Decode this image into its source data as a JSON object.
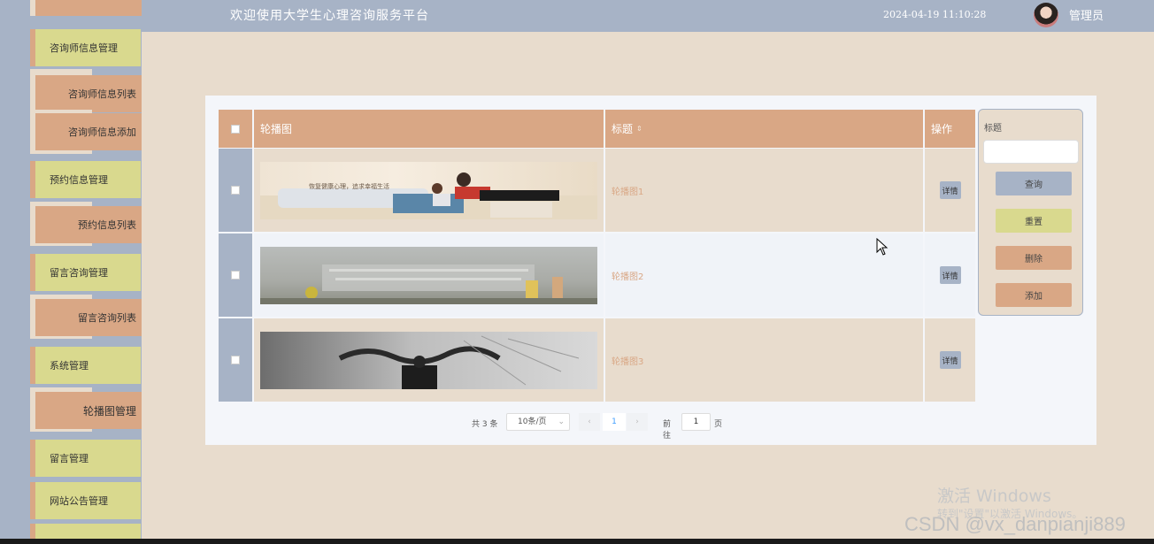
{
  "topbar": {
    "title": "欢迎使用大学生心理咨询服务平台",
    "datetime": "2024-04-19 11:10:28",
    "role": "管理员"
  },
  "sidebar": {
    "items": [
      {
        "label": "咨询师信息管理",
        "type": "main"
      },
      {
        "label": "咨询师信息列表",
        "type": "sub"
      },
      {
        "label": "咨询师信息添加",
        "type": "sub"
      },
      {
        "label": "预约信息管理",
        "type": "main"
      },
      {
        "label": "预约信息列表",
        "type": "sub"
      },
      {
        "label": "留言咨询管理",
        "type": "main"
      },
      {
        "label": "留言咨询列表",
        "type": "sub"
      },
      {
        "label": "系统管理",
        "type": "main"
      },
      {
        "label": "轮播图管理",
        "type": "sub"
      },
      {
        "label": "留言管理",
        "type": "main"
      },
      {
        "label": "网站公告管理",
        "type": "main"
      }
    ]
  },
  "table": {
    "headers": {
      "image": "轮播图",
      "title": "标题",
      "ops": "操作"
    },
    "rows": [
      {
        "title": "轮播图1",
        "action": "详情",
        "banner_text": "恢复健康心理，追求幸福生活"
      },
      {
        "title": "轮播图2",
        "action": "详情"
      },
      {
        "title": "轮播图3",
        "action": "详情"
      }
    ]
  },
  "search": {
    "label": "标题",
    "query": "查询",
    "reset": "重置",
    "delete": "删除",
    "add": "添加"
  },
  "pager": {
    "total": "共 3 条",
    "page_size": "10条/页",
    "current_page": "1",
    "goto": "前往",
    "goto_value": "1",
    "page_suffix": "页"
  },
  "watermark": {
    "line1": "激活 Windows",
    "line2": "转到\"设置\"以激活 Windows。",
    "csdn": "CSDN @vx_danpianji889"
  },
  "colors": {
    "slate": "#a7b3c6",
    "tan": "#d9a785",
    "olive": "#d9d98e",
    "cream": "#e8dccd"
  }
}
